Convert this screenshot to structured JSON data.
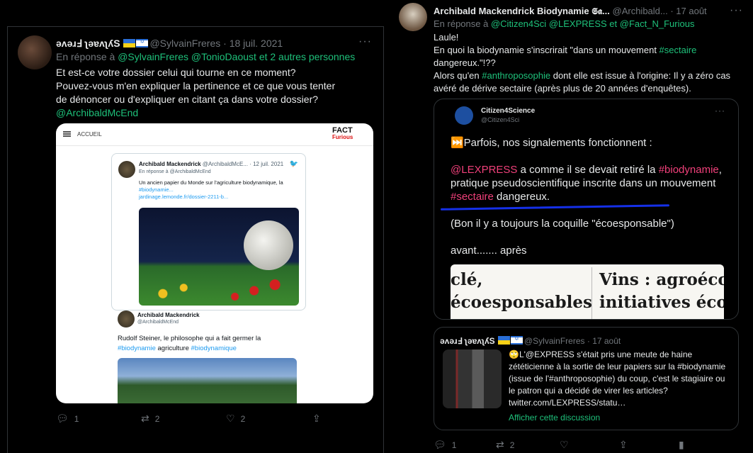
{
  "left": {
    "display_name": "ǝʌǝɹℲ ʅǝɐʌʅʎS",
    "handle": "@SylvainFreres",
    "date": "· 18 juil. 2021",
    "reply_prefix": "En réponse à",
    "reply_names": "@SylvainFreres @TonioDaoust",
    "reply_suffix": "et 2 autres personnes",
    "body_line1": "Et est-ce votre dossier celui qui tourne en ce moment?",
    "body_line2": "Pouvez-vous m'en expliquer la pertinence et ce que vous tenter de dénoncer ou d'expliquer en citant ça dans votre dossier?",
    "body_mention": "@ArchibaldMcEnd",
    "more": "···",
    "screenshot": {
      "accueil": "ACCUEIL",
      "logo_top": "FACT",
      "logo_bottom": "Furious",
      "name": "Archibald Mackendrick",
      "handle_date": "@ArchibaldMcE... · 12 juil. 2021",
      "reply": "En réponse à @ArchibaldMcEnd",
      "text_a": "Un ancien papier du Monde sur l'agriculture biodynamique, la ",
      "text_hashtag": "#biodynamie...",
      "text_link": "jardinage.lemonde.fr/dossier-2211-b...",
      "p2_name": "Archibald Mackendrick",
      "p2_handle": "@ArchibaldMcEnd",
      "p2_text_a": "Rudolf Steiner, le philosophe qui a fait germer la",
      "p2_hashtag1": "#biodynamie",
      "p2_text_b": " agriculture ",
      "p2_hashtag2": "#biodynamique"
    },
    "actions": {
      "replies": "1",
      "retweets": "2",
      "likes": "2"
    }
  },
  "right": {
    "display_name": "Archibald Mackendrick Biodynamie 𝕾𝖆...",
    "handle": "@Archibald...",
    "date": "· 17 août",
    "more": "···",
    "reply_prefix": "En réponse à",
    "reply_1": "@Citizen4Sci",
    "reply_2": "@LEXPRESS",
    "reply_and": "et",
    "reply_3": "@Fact_N_Furious",
    "line1": "Laule!",
    "line2a": "En quoi la biodynamie s'inscrirait \"dans un mouvement ",
    "line2_tag": "#sectaire",
    "line2b": " dangereux.\"!??",
    "line3a": "Alors qu'en ",
    "line3_tag": "#anthroposophie",
    "line3b": " dont elle est issue à l'origine: Il y a zéro cas avéré de dérive sectaire (après plus de 20 années d'enquêtes).",
    "quote1": {
      "name": "Citizen4Science",
      "handle": "@Citizen4Sci",
      "more": "···",
      "intro": "⏭️Parfois, nos signalements fonctionnent :",
      "m_lexpress": "@LEXPRESS",
      "t1": " a comme il se devait retiré la ",
      "m_biodynamie": "#biodynamie",
      "t2": ", pratique pseudoscientifique inscrite dans un mouvement ",
      "m_sectaire": "#sectaire",
      "t3": " dangereux.",
      "t4": "(Bon il y a toujours la coquille \"écoesponsable\")",
      "t5": "avant....... après",
      "paper_l1": "clé,",
      "paper_l2": "écoesponsables",
      "paper_r1": "Vins : agroécolo",
      "paper_r2": "initiatives écoes"
    },
    "quote2": {
      "display_name": "ǝʌǝɹℲ ʅǝɐʌʅʎS",
      "handle": "@SylvainFreres",
      "date": "· 17 août",
      "text": "🙄L'@EXPRESS s'était pris une meute de haine zététicienne à la sortie de leur papiers sur la #biodynamie (issue de l'#anthroposophie) du coup, c'est le stagiaire ou le patron qui a décidé de virer les articles?    twitter.com/LEXPRESS/statu…",
      "link": "Afficher cette discussion"
    },
    "actions": {
      "replies": "1",
      "retweets": "2"
    }
  }
}
